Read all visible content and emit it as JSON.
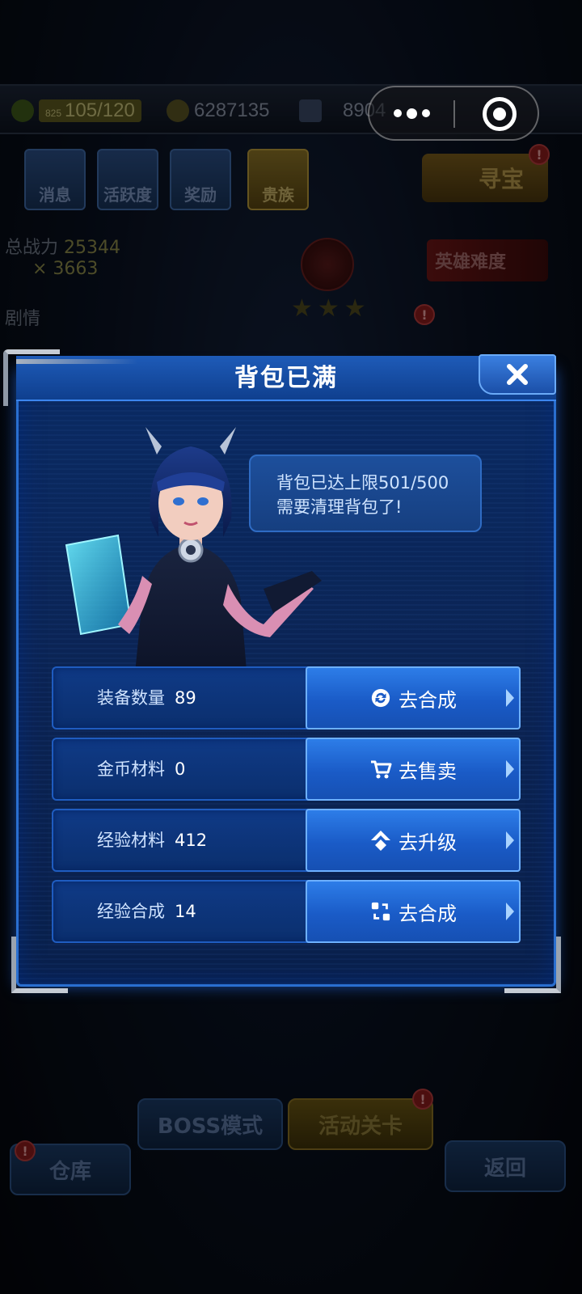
{
  "background": {
    "energy_small": "825",
    "energy": "105/120",
    "gold": "6287135",
    "diamond": "8904",
    "buttons": [
      "消息",
      "活跃度",
      "奖励",
      "贵族"
    ],
    "treasure": "寻宝",
    "power_label": "总战力",
    "power_value": "25344",
    "keys": "× 3663",
    "hero_badge": "英雄难度",
    "story_label": "剧情",
    "bottom_buttons": [
      "BOSS模式",
      "活动关卡",
      "仓库",
      "返回"
    ],
    "badge_mark": "!"
  },
  "capsule": {
    "more_icon": "more-dots-icon",
    "close_icon": "target-close-icon"
  },
  "dialog": {
    "title": "背包已满",
    "close_icon": "close-x-icon",
    "message_line1": "背包已达上限501/500",
    "message_line2": "需要清理背包了!",
    "rows": [
      {
        "label": "装备数量",
        "value": "89",
        "action": "去合成",
        "icon": "refresh-icon"
      },
      {
        "label": "金币材料",
        "value": "0",
        "action": "去售卖",
        "icon": "cart-icon"
      },
      {
        "label": "经验材料",
        "value": "412",
        "action": "去升级",
        "icon": "upgrade-icon"
      },
      {
        "label": "经验合成",
        "value": "14",
        "action": "去合成",
        "icon": "merge-icon"
      }
    ]
  },
  "colors": {
    "panel": "#0b2352",
    "accent": "#2a6fd0",
    "button": "#1a5bc7"
  }
}
